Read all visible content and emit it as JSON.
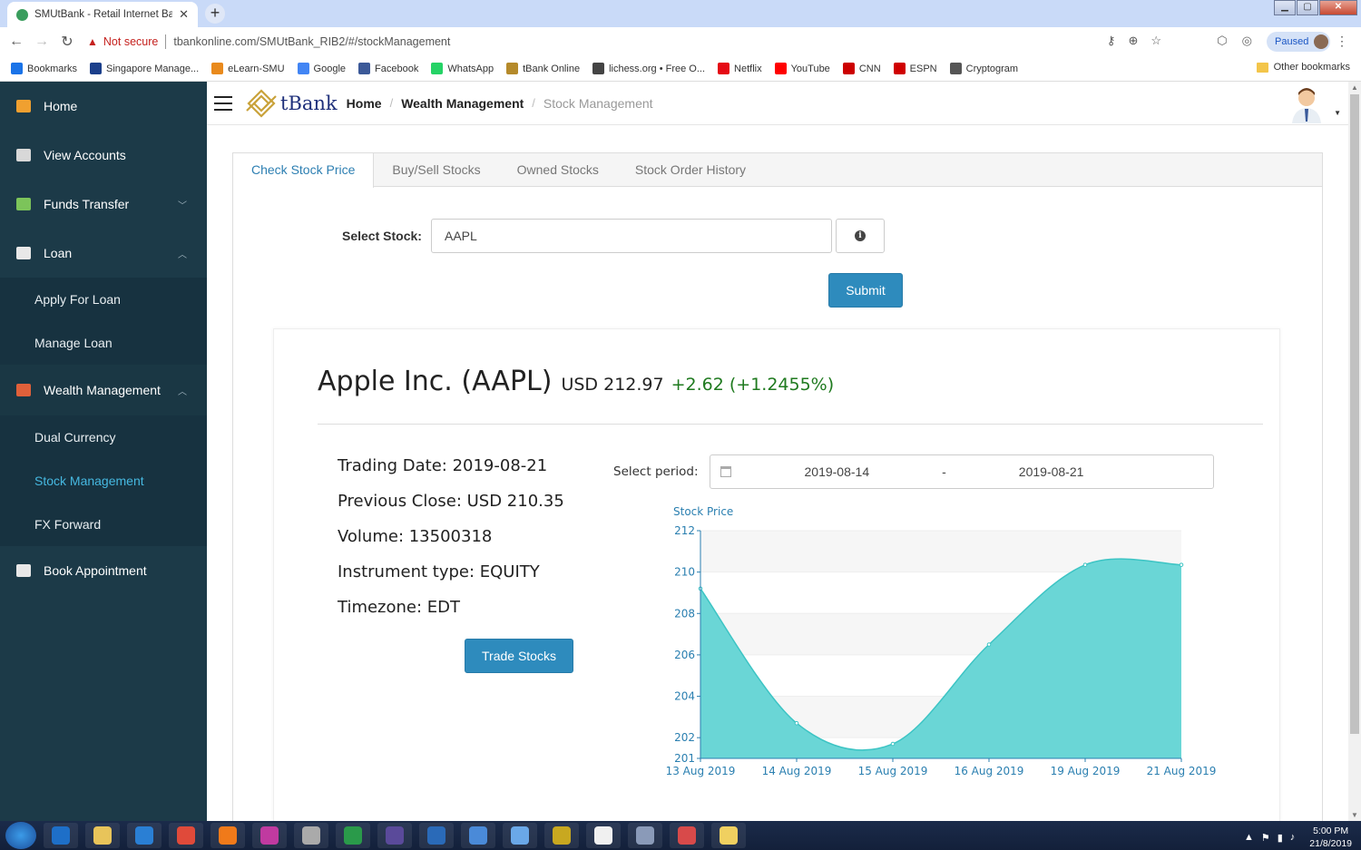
{
  "browser": {
    "tab_title": "SMUtBank - Retail Internet Banki",
    "new_tab": "+",
    "security_label": "Not secure",
    "url": "tbankonline.com/SMUtBank_RIB2/#/stockManagement",
    "profile_status": "Paused",
    "bookmarks": [
      {
        "label": "Bookmarks",
        "color": "#1a73e8"
      },
      {
        "label": "Singapore Manage...",
        "color": "#1b3f8b"
      },
      {
        "label": "eLearn-SMU",
        "color": "#e98a1d"
      },
      {
        "label": "Google",
        "color": "#4285f4"
      },
      {
        "label": "Facebook",
        "color": "#3b5998"
      },
      {
        "label": "WhatsApp",
        "color": "#25d366"
      },
      {
        "label": "tBank Online",
        "color": "#b58a2a"
      },
      {
        "label": "lichess.org • Free O...",
        "color": "#444444"
      },
      {
        "label": "Netflix",
        "color": "#e50914"
      },
      {
        "label": "YouTube",
        "color": "#ff0000"
      },
      {
        "label": "CNN",
        "color": "#cc0000"
      },
      {
        "label": "ESPN",
        "color": "#d00000"
      },
      {
        "label": "Cryptogram",
        "color": "#555555"
      }
    ],
    "other_bookmarks": "Other bookmarks"
  },
  "sidebar": {
    "items": [
      {
        "label": "Home",
        "icon": "home-icon",
        "color": "#f0a030"
      },
      {
        "label": "View Accounts",
        "icon": "card-icon",
        "color": "#d8d8d8"
      },
      {
        "label": "Funds Transfer",
        "icon": "transfer-icon",
        "color": "#7cc45a"
      },
      {
        "label": "Loan",
        "icon": "loan-icon",
        "color": "#e8e8e8"
      }
    ],
    "loan_sub": [
      "Apply For Loan",
      "Manage Loan"
    ],
    "wealth": {
      "label": "Wealth Management",
      "icon": "wealth-icon",
      "color": "#e0603a"
    },
    "wealth_sub": [
      "Dual Currency",
      "Stock Management",
      "FX Forward"
    ],
    "appointment": {
      "label": "Book Appointment",
      "icon": "calendar-icon",
      "color": "#e8e8e8"
    }
  },
  "header": {
    "logo_text": "tBank",
    "breadcrumb": [
      "Home",
      "Wealth Management",
      "Stock Management"
    ],
    "separator": "/"
  },
  "tabs": [
    "Check Stock Price",
    "Buy/Sell Stocks",
    "Owned Stocks",
    "Stock Order History"
  ],
  "form": {
    "label": "Select Stock:",
    "value": "AAPL",
    "info_icon": "i",
    "submit": "Submit"
  },
  "stock": {
    "name": "Apple Inc. (AAPL)",
    "price": "USD 212.97",
    "change": "+2.62 (+1.2455%)",
    "facts": [
      "Trading Date: 2019-08-21",
      "Previous Close: USD 210.35",
      "Volume: 13500318",
      "Instrument type: EQUITY",
      "Timezone: EDT"
    ],
    "trade_button": "Trade Stocks"
  },
  "period": {
    "label": "Select period:",
    "start": "2019-08-14",
    "dash": "-",
    "end": "2019-08-21"
  },
  "chart_data": {
    "type": "area",
    "title": "Stock Price",
    "x": [
      "13 Aug 2019",
      "14 Aug 2019",
      "15 Aug 2019",
      "16 Aug 2019",
      "19 Aug 2019",
      "21 Aug 2019"
    ],
    "y": [
      209.2,
      202.7,
      201.7,
      206.5,
      210.35,
      210.35
    ],
    "ylim": [
      201,
      212
    ],
    "yticks": [
      201,
      202,
      204,
      206,
      208,
      210,
      212
    ],
    "fill_color": "#6ad6d6",
    "line_color": "#3cc4c4",
    "grid": true
  },
  "taskbar": {
    "apps": [
      "outlook",
      "explorer",
      "ie",
      "chrome",
      "firefox",
      "app",
      "settings",
      "app",
      "eclipse",
      "vscode",
      "box",
      "box",
      "jar",
      "apps",
      "sas",
      "snip",
      "notes"
    ],
    "app_colors": [
      "#1e6fc8",
      "#e8c45a",
      "#2a7fd4",
      "#e04a3a",
      "#f07a1a",
      "#c03aa0",
      "#aaaaaa",
      "#2a9a4a",
      "#5a4a9a",
      "#2a6ab8",
      "#4a8ad8",
      "#6aa8e8",
      "#c8a820",
      "#f0f0f0",
      "#8a9ab8",
      "#d84a4a",
      "#f0d060"
    ],
    "time": "5:00 PM",
    "date": "21/8/2019"
  }
}
